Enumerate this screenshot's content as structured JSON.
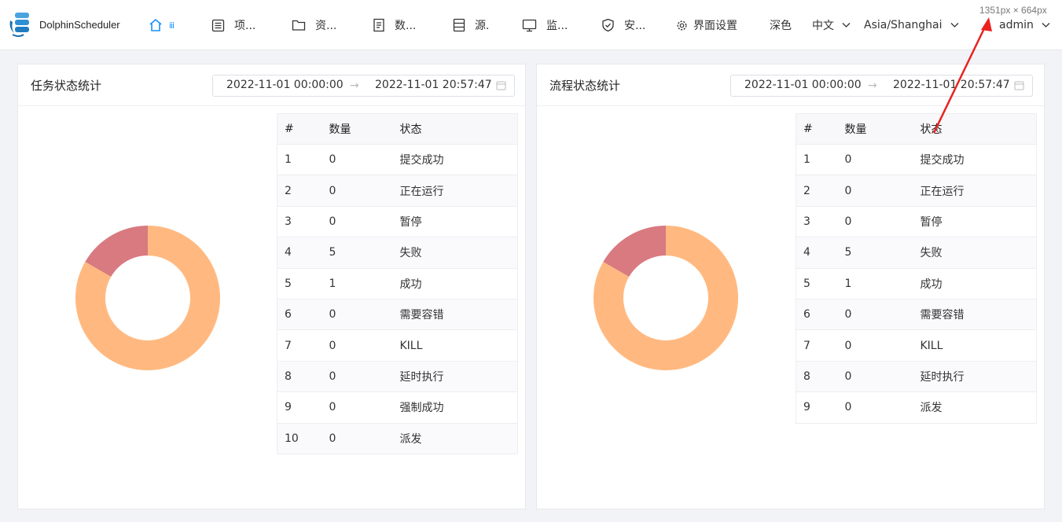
{
  "app": {
    "name": "DolphinScheduler"
  },
  "nav": {
    "items": [
      {
        "label": "",
        "icon": "home-icon"
      },
      {
        "label": "项...",
        "icon": "list-icon"
      },
      {
        "label": "资...",
        "icon": "folder-icon"
      },
      {
        "label": "数...",
        "icon": "document-icon"
      },
      {
        "label": "源.",
        "icon": "database-icon"
      },
      {
        "label": "监...",
        "icon": "monitor-icon"
      },
      {
        "label": "安...",
        "icon": "shield-icon"
      },
      {
        "label": "界面设置",
        "icon": "gear-icon"
      }
    ],
    "theme": "深色",
    "language": "中文",
    "timezone": "Asia/Shanghai",
    "user": "admin"
  },
  "overlay": {
    "dimensions": "1351px × 664px",
    "arrow_color": "#e8231f"
  },
  "colors": {
    "accent": "#1890ff",
    "donut_main": "#ffb980",
    "donut_secondary": "#d87a80"
  },
  "task_panel": {
    "title": "任务状态统计",
    "start": "2022-11-01 00:00:00",
    "end": "2022-11-01 20:57:47",
    "headers": [
      "#",
      "数量",
      "状态"
    ],
    "rows": [
      [
        "1",
        "0",
        "提交成功"
      ],
      [
        "2",
        "0",
        "正在运行"
      ],
      [
        "3",
        "0",
        "暂停"
      ],
      [
        "4",
        "5",
        "失败"
      ],
      [
        "5",
        "1",
        "成功"
      ],
      [
        "6",
        "0",
        "需要容错"
      ],
      [
        "7",
        "0",
        "KILL"
      ],
      [
        "8",
        "0",
        "延时执行"
      ],
      [
        "9",
        "0",
        "强制成功"
      ],
      [
        "10",
        "0",
        "派发"
      ]
    ]
  },
  "process_panel": {
    "title": "流程状态统计",
    "start": "2022-11-01 00:00:00",
    "end": "2022-11-01 20:57:47",
    "headers": [
      "#",
      "数量",
      "状态"
    ],
    "rows": [
      [
        "1",
        "0",
        "提交成功"
      ],
      [
        "2",
        "0",
        "正在运行"
      ],
      [
        "3",
        "0",
        "暂停"
      ],
      [
        "4",
        "5",
        "失败"
      ],
      [
        "5",
        "1",
        "成功"
      ],
      [
        "6",
        "0",
        "需要容错"
      ],
      [
        "7",
        "0",
        "KILL"
      ],
      [
        "8",
        "0",
        "延时执行"
      ],
      [
        "9",
        "0",
        "派发"
      ]
    ]
  },
  "chart_data": [
    {
      "type": "pie",
      "categories": [
        "失败",
        "成功"
      ],
      "values": [
        5,
        1
      ],
      "colors": [
        "#ffb980",
        "#d87a80"
      ]
    },
    {
      "type": "pie",
      "categories": [
        "失败",
        "成功"
      ],
      "values": [
        5,
        1
      ],
      "colors": [
        "#ffb980",
        "#d87a80"
      ]
    }
  ]
}
